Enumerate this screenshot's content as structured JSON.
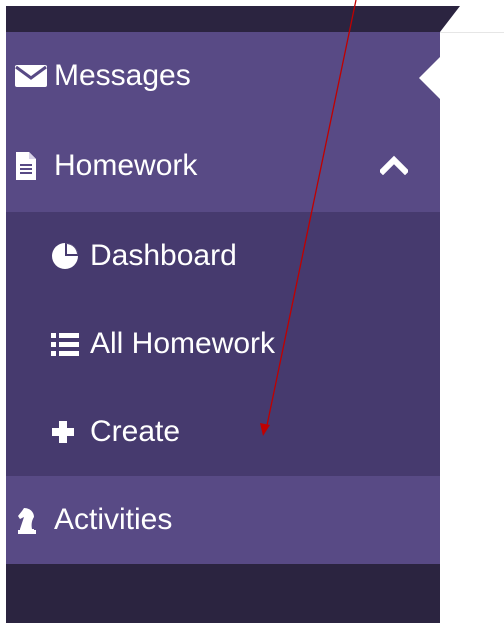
{
  "sidebar": {
    "items": [
      {
        "label": "Messages",
        "icon": "envelope-icon",
        "active": true
      },
      {
        "label": "Homework",
        "icon": "document-icon",
        "expanded": true
      },
      {
        "label": "Activities",
        "icon": "chess-knight-icon"
      }
    ],
    "homework_submenu": [
      {
        "label": "Dashboard",
        "icon": "pie-chart-icon"
      },
      {
        "label": "All Homework",
        "icon": "list-icon"
      },
      {
        "label": "Create",
        "icon": "plus-icon"
      }
    ]
  },
  "colors": {
    "sidebar_dark": "#2b2440",
    "sidebar_item": "#584a85",
    "submenu_bg": "#463a6e",
    "annotation_arrow": "#c00000"
  },
  "annotation": {
    "type": "arrow",
    "color": "#c00000"
  }
}
